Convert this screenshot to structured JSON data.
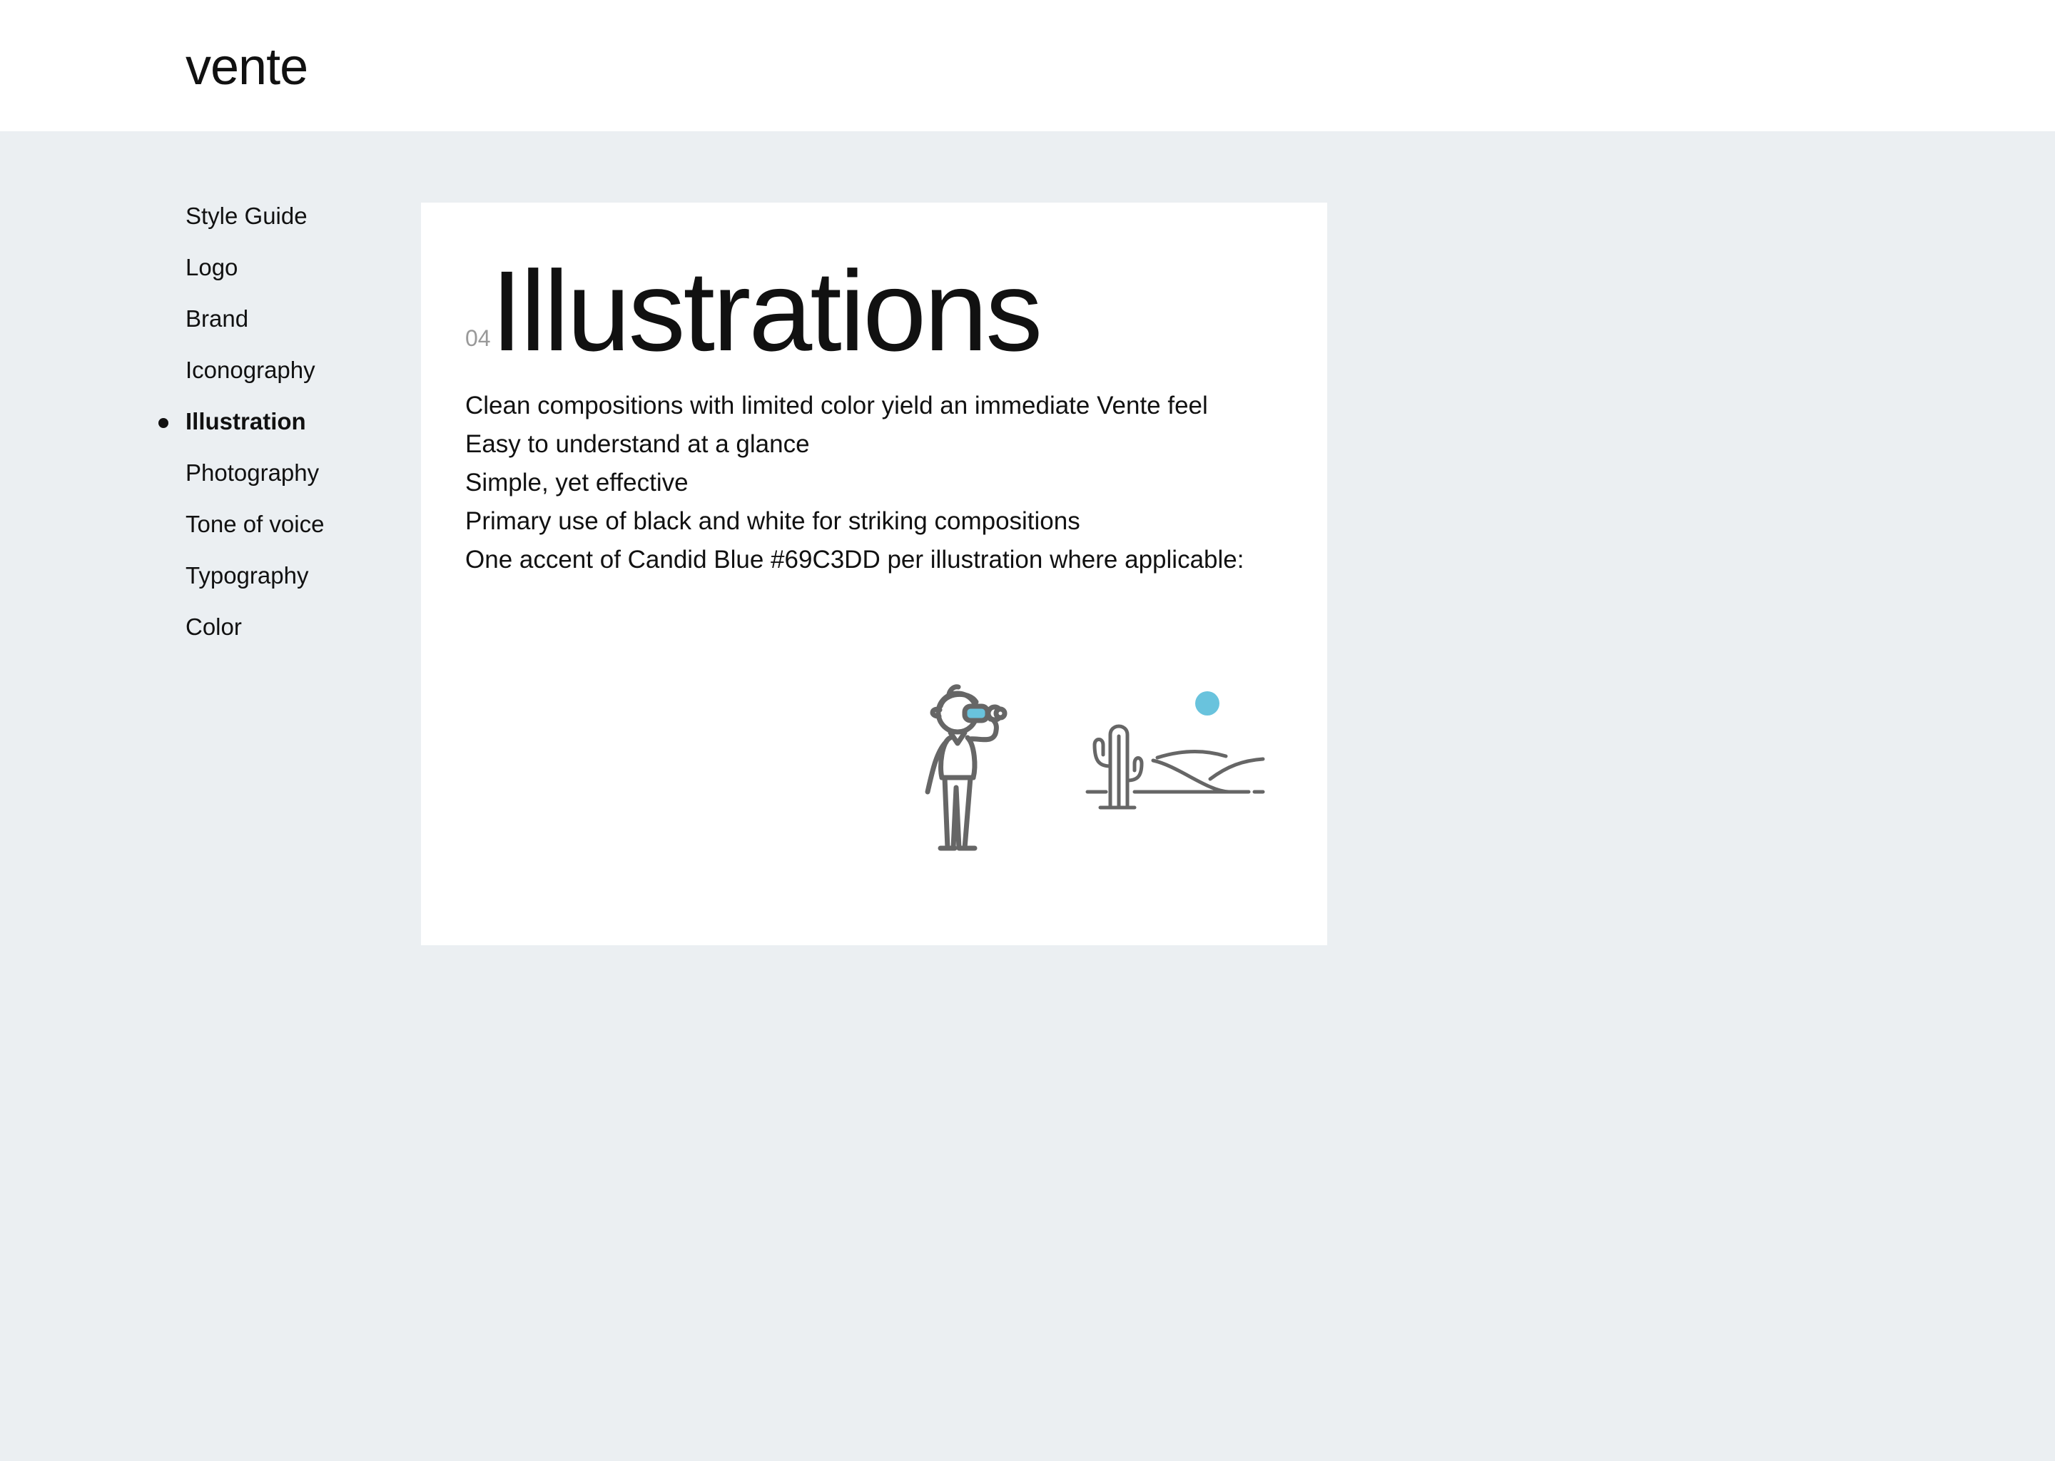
{
  "header": {
    "brand": "vente"
  },
  "sidebar": {
    "items": [
      {
        "label": "Style Guide",
        "active": false
      },
      {
        "label": "Logo",
        "active": false
      },
      {
        "label": "Brand",
        "active": false
      },
      {
        "label": "Iconography",
        "active": false
      },
      {
        "label": "Illustration",
        "active": true
      },
      {
        "label": "Photography",
        "active": false
      },
      {
        "label": "Tone of voice",
        "active": false
      },
      {
        "label": "Typography",
        "active": false
      },
      {
        "label": "Color",
        "active": false
      }
    ]
  },
  "main": {
    "section_number": "04",
    "title": "Illustrations",
    "points": [
      "Clean compositions with limited color yield an immediate Vente feel",
      "Easy to understand at a glance",
      "Simple, yet effective",
      "Primary use of black and white for striking compositions",
      "One accent of Candid Blue #69C3DD per illustration where applicable:"
    ],
    "illustrations": {
      "person": "person-with-binoculars-icon",
      "landscape": "desert-cactus-sun-icon"
    }
  },
  "colors": {
    "background": "#ebeff2",
    "card": "#ffffff",
    "text": "#111111",
    "muted": "#999999",
    "line_art": "#666666",
    "accent": "#69C3DD"
  }
}
